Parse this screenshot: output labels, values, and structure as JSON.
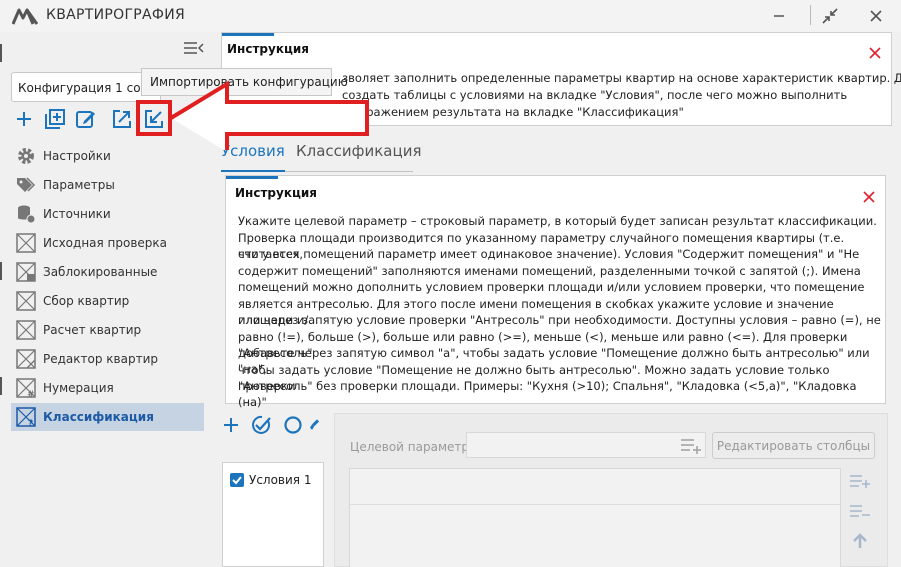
{
  "app": {
    "title": "КВАРТИРОГРАФИЯ",
    "logo_icon": "app-logo-icon"
  },
  "window_controls": [
    "minimize-icon",
    "restore-icon",
    "close-icon"
  ],
  "sidebar": {
    "config_selected": "Конфигурация 1 сору",
    "tooltip": "Импортировать конфигурацию",
    "toolbar_icons": [
      "add-icon",
      "duplicate-icon",
      "edit-icon",
      "export-icon",
      "import-icon",
      "delete-icon"
    ],
    "items": [
      {
        "label": "Настройки",
        "icon": "gear-icon"
      },
      {
        "label": "Параметры",
        "icon": "tags-icon"
      },
      {
        "label": "Источники",
        "icon": "database-icon"
      },
      {
        "label": "Исходная проверка",
        "icon": "check-icon"
      },
      {
        "label": "Заблокированные",
        "icon": "locked-icon"
      },
      {
        "label": "Сбор квартир",
        "icon": "collect-icon"
      },
      {
        "label": "Расчет квартир",
        "icon": "calc-icon"
      },
      {
        "label": "Редактор квартир",
        "icon": "editor-icon"
      },
      {
        "label": "Нумерация",
        "icon": "numbering-icon"
      },
      {
        "label": "Классификация",
        "icon": "classification-icon",
        "active": true
      }
    ]
  },
  "main": {
    "top_info": {
      "title": "Инструкция",
      "line1": "зволяет заполнить определенные параметры квартир на основе характеристик квартир. Для",
      "line2": "создать таблицы с условиями на вкладке \"Условия\", после чего можно выполнить",
      "line3": "классификацию с отображением результата на вкладке \"Классификация\""
    },
    "tabs": [
      {
        "label": "Условия",
        "active": true
      },
      {
        "label": "Классификация",
        "active": false
      }
    ],
    "inner_info": {
      "title": "Инструкция",
      "lines": [
        "Укажите целевой параметр – строковый параметр, в который будет записан результат классификации.",
        "Проверка площади производится по указанному параметру случайного помещения квартиры (т.е. считается,",
        "что у всех помещений параметр имеет одинаковое значение). Условия \"Содержит помещения\" и \"Не",
        "содержит помещений\" заполняются именами помещений, разделенными точкой с запятой (;). Имена",
        "помещений можно дополнить условием проверки площади и/или условием проверки, что помещение",
        "является антресолью. Для этого после имени помещения в скобках укажите условие и значение площади и/",
        "или через запятую условие проверки \"Антресоль\" при необходимости. Доступны условия – равно (=), не",
        "равно (!=), больше (>), больше или равно (>=), меньше (<), меньше или равно (<=). Для проверки \"Антресоль\"",
        "добавьте через запятую символ \"а\", чтобы задать условие \"Помещение должно быть антресолью\" или \"на\",",
        "чтобы задать условие \"Помещение не должно быть антресолью\". Можно задать условие только проверки",
        "\"Антресоль\" без проверки площади. Примеры: \"Кухня (>10); Спальня\", \"Кладовка (<5,а)\", \"Кладовка (на)\""
      ]
    },
    "conditions": {
      "items": [
        {
          "label": "Условия 1",
          "checked": true
        }
      ],
      "target_param_label": "Целевой параметр",
      "target_param_value": "",
      "edit_columns_label": "Редактировать столбцы"
    }
  },
  "colors": {
    "accent": "#1c75bc",
    "highlight_red": "#e02020",
    "active_nav_bg": "#c6d3e2"
  }
}
